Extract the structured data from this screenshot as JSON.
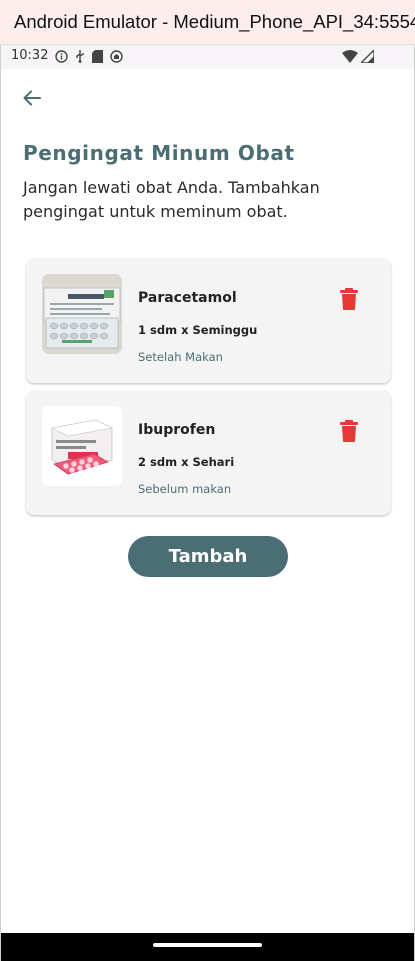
{
  "window": {
    "title": "Android Emulator - Medium_Phone_API_34:5554"
  },
  "status_bar": {
    "time": "10:32",
    "icons": [
      "info-icon",
      "usb-icon",
      "sd-card-icon",
      "notification-icon"
    ],
    "right_icons": [
      "wifi-icon",
      "signal-icon"
    ]
  },
  "header": {
    "back_icon": "arrow-left-icon",
    "title": "Pengingat Minum Obat",
    "subtitle": "Jangan lewati obat Anda. Tambahkan pengingat untuk meminum obat."
  },
  "medications": [
    {
      "name": "Paracetamol",
      "dose": "1 sdm x Seminggu",
      "note": "Setelah Makan",
      "image_icon": "paracetamol-box-image"
    },
    {
      "name": "Ibuprofen",
      "dose": "2 sdm x Sehari",
      "note": "Sebelum makan",
      "image_icon": "ibuprofen-box-image"
    }
  ],
  "actions": {
    "delete_icon": "trash-icon",
    "add_label": "Tambah"
  },
  "colors": {
    "accent": "#4b6d74",
    "delete": "#e53935",
    "card_bg": "#f4f4f4"
  }
}
